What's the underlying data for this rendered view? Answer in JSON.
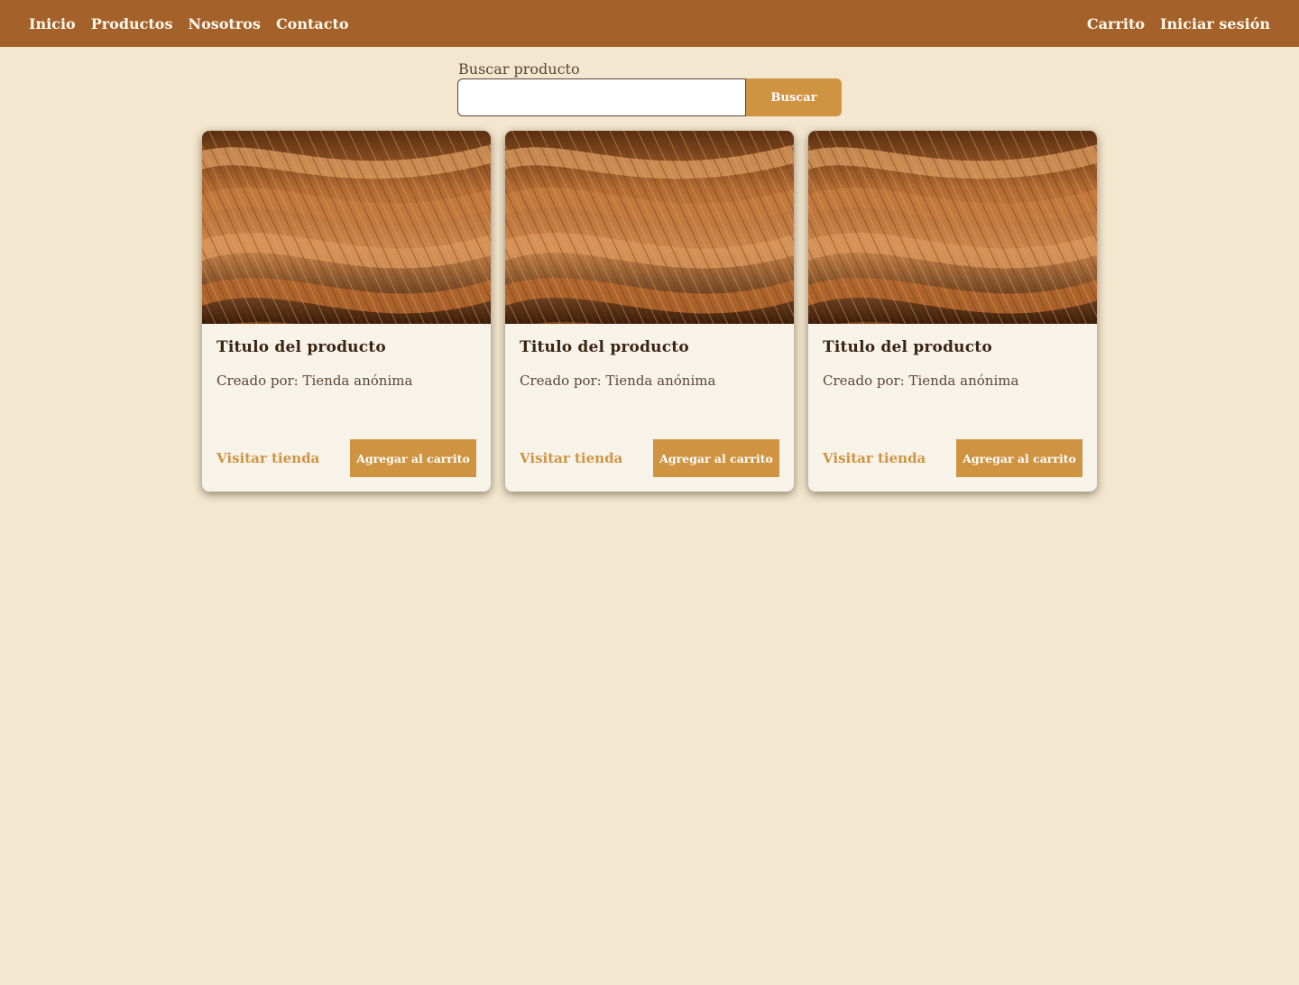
{
  "nav": {
    "left": [
      "Inicio",
      "Productos",
      "Nosotros",
      "Contacto"
    ],
    "right": [
      "Carrito",
      "Iniciar sesión"
    ]
  },
  "search": {
    "label": "Buscar producto",
    "value": "",
    "button_label": "Buscar"
  },
  "products": [
    {
      "title": "Titulo del producto",
      "author": "Creado por: Tienda anónima",
      "visit_label": "Visitar tienda",
      "add_label": "Agregar al carrito"
    },
    {
      "title": "Titulo del producto",
      "author": "Creado por: Tienda anónima",
      "visit_label": "Visitar tienda",
      "add_label": "Agregar al carrito"
    },
    {
      "title": "Titulo del producto",
      "author": "Creado por: Tienda anónima",
      "visit_label": "Visitar tienda",
      "add_label": "Agregar al carrito"
    }
  ],
  "colors": {
    "navbar": "#a46129",
    "background": "#f3e7cf",
    "accent": "#cf9442",
    "card": "#f8f3e9"
  }
}
